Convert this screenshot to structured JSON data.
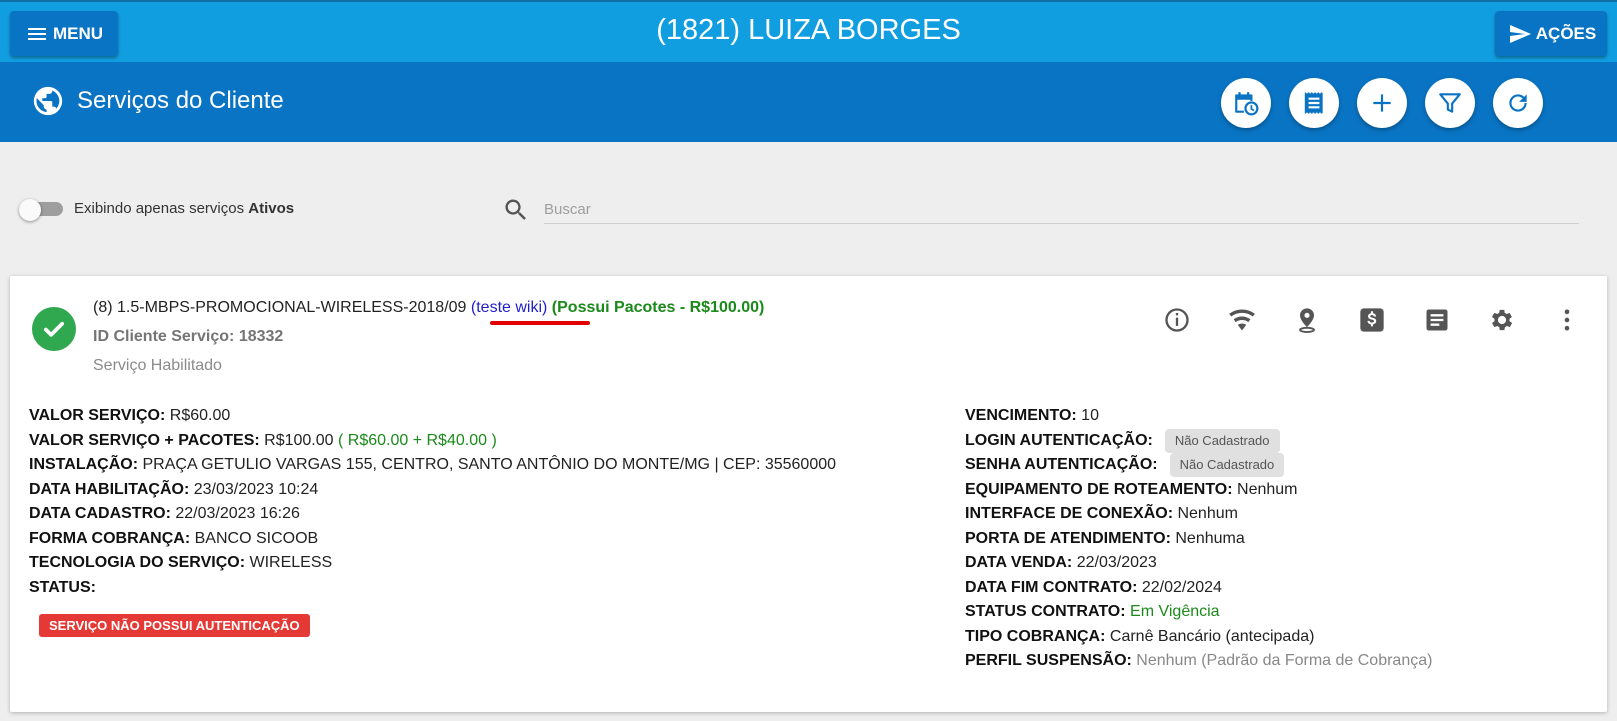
{
  "topbar": {
    "menu_label": "MENU",
    "title": "(1821) LUIZA BORGES",
    "acoes_label": "AÇÕES"
  },
  "section": {
    "title": "Serviços do Cliente",
    "actions": [
      "calendar-clock-icon",
      "receipt-icon",
      "add-icon",
      "filter-icon",
      "refresh-icon"
    ]
  },
  "filter": {
    "label_prefix": "Exibindo apenas serviços ",
    "label_bold": "Ativos",
    "search_placeholder": "Buscar",
    "search_value": ""
  },
  "service": {
    "name": "(8) 1.5-MBPS-PROMOCIONAL-WIRELESS-2018/09",
    "wiki_link": "(teste wiki)",
    "pacotes": "(Possui Pacotes - R$100.00)",
    "id_label": "ID Cliente Serviço:",
    "id_value": "18332",
    "status_text": "Serviço Habilitado",
    "icons": [
      "info-icon",
      "wifi-icon",
      "location-icon",
      "billing-icon",
      "notes-icon",
      "settings-icon",
      "more-icon"
    ],
    "left": {
      "valor_servico_label": "VALOR SERVIÇO:",
      "valor_servico": "R$60.00",
      "valor_pacotes_label": "VALOR SERVIÇO + PACOTES:",
      "valor_pacotes": "R$100.00",
      "valor_pacotes_detail": "( R$60.00 + R$40.00 )",
      "instalacao_label": "INSTALAÇÃO:",
      "instalacao": "PRAÇA GETULIO VARGAS 155, CENTRO, SANTO ANTÔNIO DO MONTE/MG | CEP: 35560000",
      "data_habilitacao_label": "DATA HABILITAÇÃO:",
      "data_habilitacao": "23/03/2023 10:24",
      "data_cadastro_label": "DATA CADASTRO:",
      "data_cadastro": "22/03/2023 16:26",
      "forma_cobranca_label": "FORMA COBRANÇA:",
      "forma_cobranca": "BANCO SICOOB",
      "tecnologia_label": "TECNOLOGIA DO SERVIÇO:",
      "tecnologia": "WIRELESS",
      "status_label": "STATUS:",
      "status_badge": "SERVIÇO NÃO POSSUI AUTENTICAÇÃO"
    },
    "right": {
      "vencimento_label": "VENCIMENTO:",
      "vencimento": "10",
      "login_label": "LOGIN AUTENTICAÇÃO:",
      "login": "Não Cadastrado",
      "senha_label": "SENHA AUTENTICAÇÃO:",
      "senha": "Não Cadastrado",
      "equipamento_label": "EQUIPAMENTO DE ROTEAMENTO:",
      "equipamento": "Nenhum",
      "interface_label": "INTERFACE DE CONEXÃO:",
      "interface": "Nenhum",
      "porta_label": "PORTA DE ATENDIMENTO:",
      "porta": "Nenhuma",
      "data_venda_label": "DATA VENDA:",
      "data_venda": "22/03/2023",
      "data_fim_label": "DATA FIM CONTRATO:",
      "data_fim": "22/02/2024",
      "status_contrato_label": "STATUS CONTRATO:",
      "status_contrato": "Em Vigência",
      "tipo_cobranca_label": "TIPO COBRANÇA:",
      "tipo_cobranca": "Carnê Bancário (antecipada)",
      "perfil_label": "PERFIL SUSPENSÃO:",
      "perfil": "Nenhum (Padrão da Forma de Cobrança)"
    }
  },
  "colors": {
    "topbar": "#119ee0",
    "header": "#0a74c4",
    "success": "#2fa84f",
    "danger": "#e53935",
    "link": "#1f1fc9",
    "green_text": "#1b8a1b"
  }
}
